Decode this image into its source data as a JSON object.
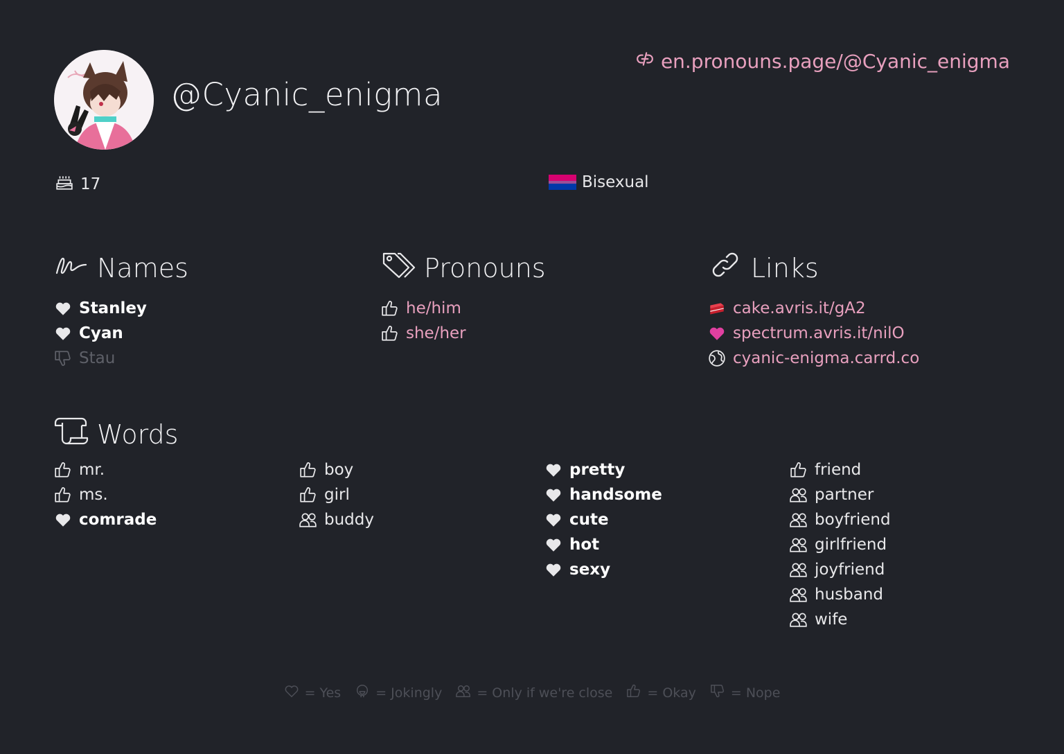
{
  "profile": {
    "username": "@Cyanic_enigma",
    "url": "en.pronouns.page/@Cyanic_enigma",
    "age": "17",
    "flag_label": "Bisexual",
    "flag_colors": [
      "#D60270",
      "#9B4F96",
      "#0038A8"
    ]
  },
  "names": {
    "title": "Names",
    "items": [
      {
        "label": "Stanley",
        "opinion": "yes"
      },
      {
        "label": "Cyan",
        "opinion": "yes"
      },
      {
        "label": "Stau",
        "opinion": "no"
      }
    ]
  },
  "pronouns": {
    "title": "Pronouns",
    "items": [
      {
        "label": "he/him",
        "opinion": "okay"
      },
      {
        "label": "she/her",
        "opinion": "okay"
      }
    ]
  },
  "links": {
    "title": "Links",
    "items": [
      {
        "label": "cake.avris.it/gA2",
        "icon": "cake-icon"
      },
      {
        "label": "spectrum.avris.it/nilO",
        "icon": "heart-icon"
      },
      {
        "label": "cyanic-enigma.carrd.co",
        "icon": "globe-icon"
      }
    ]
  },
  "words": {
    "title": "Words",
    "columns": [
      [
        {
          "label": "mr.",
          "opinion": "okay"
        },
        {
          "label": "ms.",
          "opinion": "okay"
        },
        {
          "label": "comrade",
          "opinion": "yes"
        }
      ],
      [
        {
          "label": "boy",
          "opinion": "okay"
        },
        {
          "label": "girl",
          "opinion": "okay"
        },
        {
          "label": "buddy",
          "opinion": "close"
        }
      ],
      [
        {
          "label": "pretty",
          "opinion": "yes"
        },
        {
          "label": "handsome",
          "opinion": "yes"
        },
        {
          "label": "cute",
          "opinion": "yes"
        },
        {
          "label": "hot",
          "opinion": "yes"
        },
        {
          "label": "sexy",
          "opinion": "yes"
        }
      ],
      [
        {
          "label": "friend",
          "opinion": "okay"
        },
        {
          "label": "partner",
          "opinion": "close"
        },
        {
          "label": "boyfriend",
          "opinion": "close"
        },
        {
          "label": "girlfriend",
          "opinion": "close"
        },
        {
          "label": "joyfriend",
          "opinion": "close"
        },
        {
          "label": "husband",
          "opinion": "close"
        },
        {
          "label": "wife",
          "opinion": "close"
        }
      ]
    ]
  },
  "legend": [
    {
      "icon": "yes",
      "label": "= Yes"
    },
    {
      "icon": "jokingly",
      "label": "= Jokingly"
    },
    {
      "icon": "close",
      "label": "= Only if we're close"
    },
    {
      "icon": "okay",
      "label": "= Okay"
    },
    {
      "icon": "no",
      "label": "= Nope"
    }
  ]
}
